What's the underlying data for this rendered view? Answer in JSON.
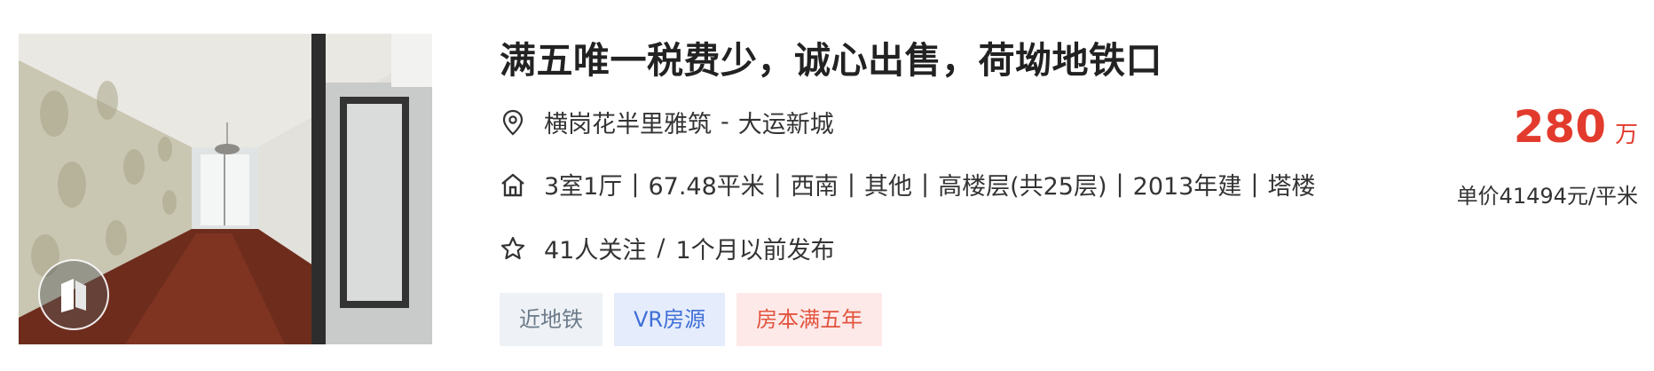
{
  "listing": {
    "title": "满五唯一税费少，诚心出售，荷坳地铁口",
    "location": {
      "community": "横岗花半里雅筑",
      "separator": "-",
      "area": "大运新城"
    },
    "house_info": {
      "items": [
        "3室1厅",
        "67.48平米",
        "西南",
        "其他",
        "高楼层(共25层)",
        "2013年建",
        "塔楼"
      ],
      "separator": "|"
    },
    "follow_info": {
      "followers": "41人关注",
      "separator": "/",
      "published": "1个月以前发布"
    },
    "tags": [
      "近地铁",
      "VR房源",
      "房本满五年"
    ],
    "price": {
      "total": "280",
      "unit": "万",
      "unit_price": "单价41494元/平米"
    },
    "icons": {
      "location": "location-pin-icon",
      "house": "house-icon",
      "follow": "star-icon",
      "vr": "vr-logo-icon"
    },
    "colors": {
      "price": "#e23b2e",
      "tag_subway_bg": "#eef2f6",
      "tag_vr_bg": "#e5ecfb",
      "tag_five_bg": "#fde9e8"
    }
  }
}
